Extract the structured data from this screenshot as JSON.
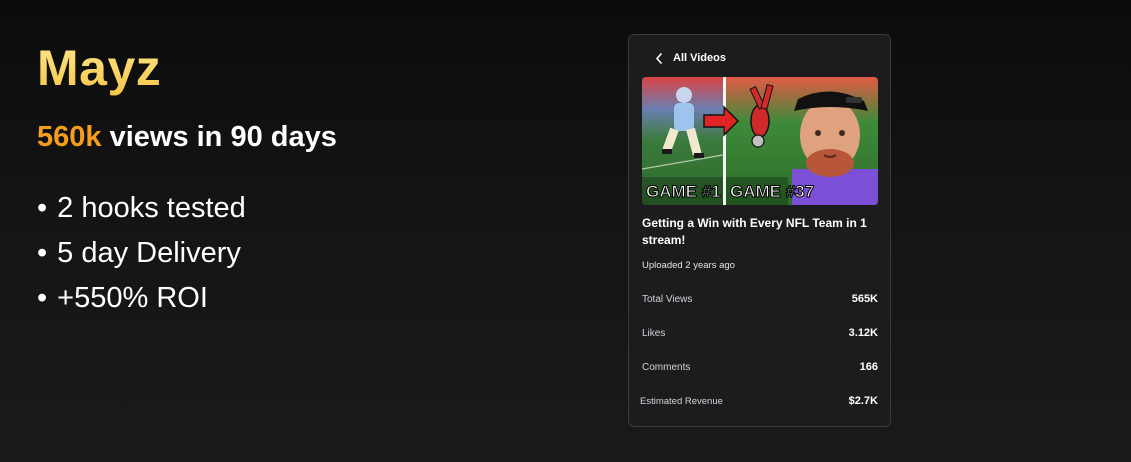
{
  "headline": {
    "name": "Mayz",
    "views_accent": "560k",
    "views_rest": " views in 90 days"
  },
  "bullets": [
    "2 hooks tested",
    "5 day Delivery",
    "+550% ROI"
  ],
  "bullet_glyph": "•",
  "card": {
    "back_label": "All Videos",
    "thumbnail": {
      "left_caption": "GAME #1",
      "right_caption": "GAME #37"
    },
    "video_title": "Getting a Win with Every NFL Team in 1 stream!",
    "uploaded": "Uploaded 2 years ago",
    "stats": [
      {
        "label": "Total Views",
        "value": "565K"
      },
      {
        "label": "Likes",
        "value": "3.12K"
      },
      {
        "label": "Comments",
        "value": "166"
      },
      {
        "label": "Estimated Revenue",
        "value": "$2.7K"
      }
    ]
  },
  "colors": {
    "accent_orange": "#f59e1b",
    "title_gold": "#fbd45a",
    "card_bg": "#1c1c1e",
    "background": "#141414"
  },
  "icons": {
    "back": "chevron-left-icon"
  }
}
